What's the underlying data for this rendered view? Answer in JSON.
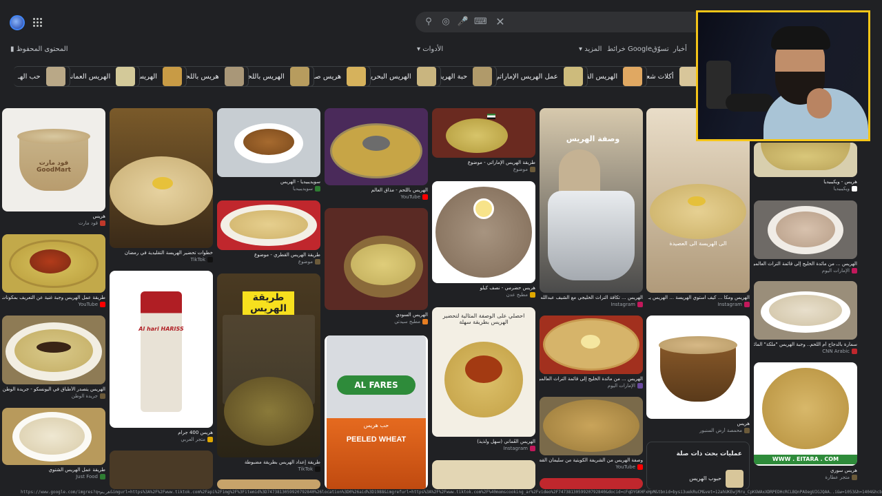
{
  "topbar": {
    "filters_right": [
      "أخبار",
      "تسوّق",
      "خرائط Google",
      "المزيد"
    ],
    "tools": "الأدوات",
    "saved": "المحتوى المحفوظ"
  },
  "chips": [
    "أكلات شعبية",
    "الهريس القطري",
    "عمل الهريس الإماراتي",
    "حبة الهريس",
    "الهريس البحريني",
    "هريس صافي",
    "الهريس باللحم",
    "هريس باللحم",
    "الهريسة",
    "الهريس العماني",
    "حب الهـ"
  ],
  "cards": {
    "c1": {
      "title": "هريس",
      "src": "قود مارت"
    },
    "c2": {
      "title": "خطوات تحضير الهريسة التقليدية في رمضان",
      "src": "TikTok"
    },
    "c3": {
      "title": "سويديبيديا - الهريس",
      "src": "سويديبيديا"
    },
    "c4": {
      "title": "الهريس باللحم - مذاق العالم",
      "src": "YouTube"
    },
    "c5": {
      "title": "طريقة الهريس الإماراتي - موضوع",
      "src": "موضوع"
    },
    "c6": {
      "title": "الهريس ... تكافة التراث الخليجي مع الشيف عبدالله الغاـ",
      "src": "Instagram"
    },
    "c7": {
      "title": "الهريس ومكا ... كيف استوي الهريسة ... الهريس يـ",
      "src": "Instagram"
    },
    "c8": {
      "title": "هريس - ويكيبيديا",
      "src": "ويكيبيديا"
    },
    "c9": {
      "title": "طريقة عمل الهريس وجبة غنية عن التعريف بمكونات فقط",
      "src": "YouTube"
    },
    "c10": {
      "title": "طريقة الهريس القطري - موضوع",
      "src": "موضوع"
    },
    "c11": {
      "title": "الهريس السودي",
      "src": "مطبخ سيدتي"
    },
    "c12": {
      "title": "هريس حضرمي - نصف كيلو",
      "src": "مطبخ عدن"
    },
    "c13": {
      "title": "الهريس ... من مائدة الخليج إلى قائمة التراث العالمي",
      "src": "الإمارات اليوم"
    },
    "c14": {
      "title": "الهريس يتصدر الأطباق في اليونسكو - جريدة الوطن السعودية",
      "src": "جريدة الوطن"
    },
    "c15": {
      "title": "هريس 400 جرام",
      "src": "متجر العربي"
    },
    "c16": {
      "title": "طريقة إعداد الهريس بطريقة مضبوطة",
      "src": "TikTok"
    },
    "c17": {
      "title": "الهريس العُماني (سهل ولذيذ)",
      "src": "Instagram"
    },
    "c18": {
      "title": "الهريس ... من مائدة الخليج إلى قائمة التراث العالمي",
      "src": "الإمارات اليوم"
    },
    "c19": {
      "title": "سمارة بالدجاج أم اللحم.. وجبة الهريس \"ملكة\" المائدة بسلطا...",
      "src": "CNN Arabic"
    },
    "c20": {
      "title": "طريقة عمل الهريس الشتوي",
      "src": "Just Food"
    },
    "c21": {
      "title": "وصفة الهريس من الشريفة الكويتية من سليمان القصار",
      "src": "YouTube"
    },
    "c22": {
      "title": "هريس",
      "src": "محمصة أرض السنبور"
    },
    "c23": {
      "title": "هريس سوري",
      "src": "متجر عطارة"
    }
  },
  "overlays": {
    "recipe_title": "طريقة الهريس",
    "recipe_heading": "وصفة الهريس",
    "hariss_subtitle": "الى الهريسة الى العصيدة",
    "alfares_brand": "AL FARES",
    "alfares_product": "PEELED WHEAT",
    "alfares_arabic": "حب هريس",
    "goodmart": "قود مارت GoodMart",
    "eitara": "WWW . EITARA . COM",
    "ahlan": "احصلي على الوصفة المثالية لتحضير الهريس بطريقة سهلة",
    "haris_bag": "Al hari HARISS"
  },
  "related": {
    "heading": "عمليات بحث ذات صلة",
    "item": "حبوب الهريس"
  },
  "status_url": "https://www.google.com/imgres?q=هريس&imgurl=https%3A%2F%2Fwww.tiktok.com%2Fapi%2Fimg%2F%3Fitemid%3D7473813059920792840%26location%3D0%26aid%3D1988&imgrefurl=https%3A%2F%2Fwww.tiktok.com%2F%40momscooking_ar%2Fvideo%2F7473813059920792840&docid=cFqDYGKHFxHpM&tbnid=bysi3uekRuCM&vet=12ahUKEwjMru_CpKGWAxXDRPEDHcRCLBQnPAOegUIGJQAA..i&w=1053&h=1404&hcb=2&ved=2ahUKEwjMru_CpKGWAxX",
  "colors": {
    "background": "#202124",
    "webcam_border": "#f5c518",
    "search_bg": "#303134"
  }
}
